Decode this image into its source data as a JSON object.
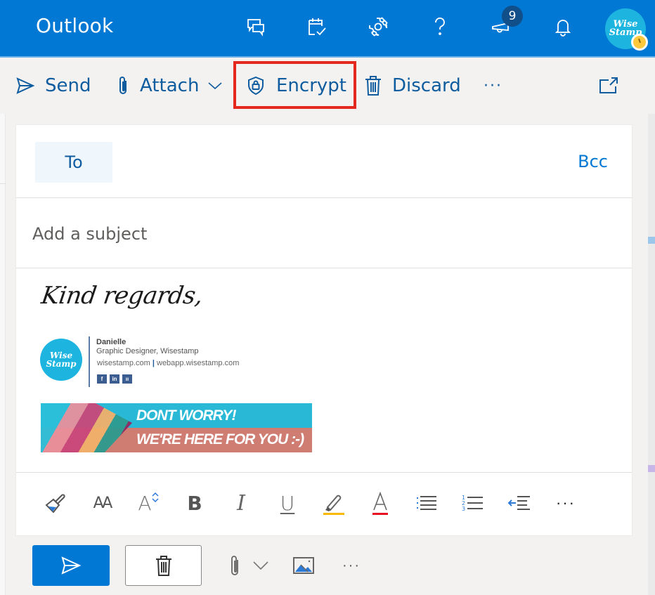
{
  "app": {
    "title": "Outlook"
  },
  "header": {
    "icons": [
      "chat-icon",
      "calendar-check-icon",
      "settings-gear-icon",
      "help-icon",
      "announcement-megaphone-icon",
      "notification-bell-icon"
    ],
    "announcement_badge": "9",
    "avatar": {
      "line1": "Wise",
      "line2": "Stamp",
      "status": "away-clock"
    }
  },
  "commandbar": {
    "send": "Send",
    "attach": "Attach",
    "encrypt": "Encrypt",
    "discard": "Discard",
    "more": "···",
    "popout_icon": "pop-out-icon",
    "highlight_color": "#e5281e"
  },
  "compose": {
    "to_label": "To",
    "to_value": "",
    "bcc_label": "Bcc",
    "subject_placeholder": "Add a subject",
    "subject_value": ""
  },
  "signature": {
    "signoff": "Kind regards,",
    "logo": {
      "line1": "Wise",
      "line2": "Stamp"
    },
    "name": "Danielle",
    "title": "Graphic Designer, Wisestamp",
    "link1": "wisestamp.com",
    "separator": "|",
    "link2": "webapp.wisestamp.com",
    "social": [
      "f",
      "in",
      "ıı"
    ],
    "banner": {
      "line1": "DONT WORRY!",
      "line2": "WE'RE HERE FOR YOU :-)"
    }
  },
  "format_toolbar": {
    "items": [
      "format-painter",
      "font-size",
      "grow-shrink-font",
      "bold",
      "italic",
      "underline",
      "highlight",
      "font-color",
      "bullets",
      "numbering",
      "decrease-indent",
      "more"
    ],
    "labels": {
      "font_size": "AA",
      "grow": "A",
      "bold": "B",
      "italic": "I",
      "underline": "U",
      "font_color": "A",
      "more": "···"
    },
    "highlight_color": "#f9b900",
    "font_color": "#e81123"
  },
  "footer": {
    "more": "···"
  },
  "colors": {
    "brand": "#0078d4",
    "link": "#0f5c9f"
  }
}
